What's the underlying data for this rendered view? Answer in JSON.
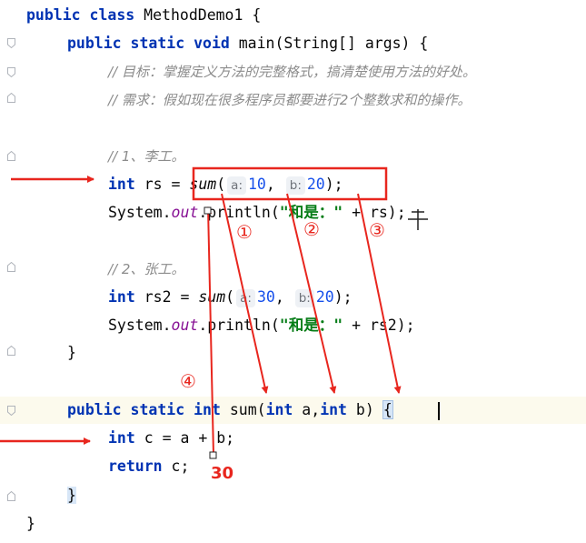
{
  "code": {
    "line1": {
      "kw": "public class",
      "name": " MethodDemo1 {"
    },
    "line2": {
      "kw": "public static void",
      "rest": " main(String[] args) {"
    },
    "line3": {
      "comment": "// 目标：掌握定义方法的完整格式，搞清楚使用方法的好处。"
    },
    "line4": {
      "comment": "// 需求：假如现在很多程序员都要进行2个整数求和的操作。"
    },
    "line6": {
      "comment": "// 1、李工。"
    },
    "line7": {
      "kw": "int",
      "var": " rs = ",
      "call": "sum",
      "paren": "(",
      "hint_a": "a:",
      "val_a": "10",
      "comma": ", ",
      "hint_b": "b:",
      "val_b": "20",
      "end": ");"
    },
    "line8": {
      "cls": "System.",
      "field": "out",
      "method": ".println(",
      "str": "\"和是：\"",
      "rest": " + rs);"
    },
    "line10": {
      "comment": "// 2、张工。"
    },
    "line11": {
      "kw": "int",
      "var": " rs2 = ",
      "call": "sum",
      "paren": "(",
      "hint_a": "a:",
      "val_a": "30",
      "comma": ", ",
      "hint_b": "b:",
      "val_b": "20",
      "end": ");"
    },
    "line12": {
      "cls": "System.",
      "field": "out",
      "method": ".println(",
      "str": "\"和是：\"",
      "rest": " + rs2);"
    },
    "line13": {
      "brace": "}"
    },
    "line15": {
      "kw": "public static int",
      "sig": " sum(",
      "kw2": "int",
      "a": " a,",
      "kw3": "int",
      "b": " b) ",
      "brace": "{"
    },
    "line16": {
      "kw": "int",
      "rest": " c = a + b;"
    },
    "line17": {
      "kw": "return",
      "rest": " c;"
    },
    "line18": {
      "brace": "}"
    },
    "line19": {
      "brace": "}"
    }
  },
  "annotations": {
    "circle1": "①",
    "circle2": "②",
    "circle3": "③",
    "circle4": "④",
    "result": "30"
  },
  "colors": {
    "annotation": "#e8261e",
    "keyword": "#0033b3",
    "number": "#1750eb",
    "string": "#067d17",
    "comment": "#8c8c8c"
  }
}
